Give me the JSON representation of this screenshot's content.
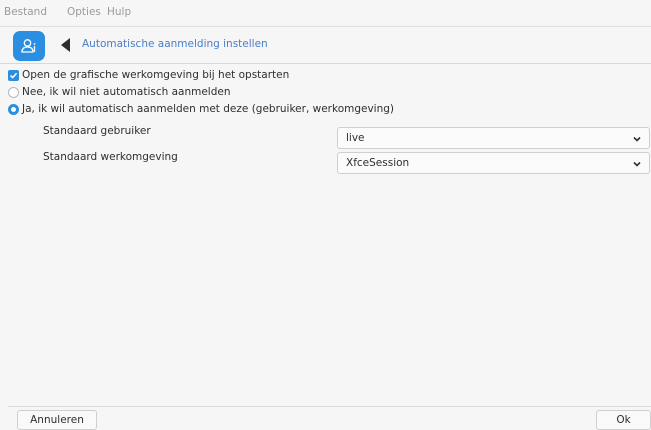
{
  "menubar": {
    "items": [
      {
        "label": "Bestand"
      },
      {
        "label": "Opties"
      },
      {
        "label": "Hulp"
      }
    ]
  },
  "header": {
    "icon": "user-autologin-icon",
    "title": "Automatische aanmelding instellen"
  },
  "options": {
    "launch_gui": {
      "label": "Open de grafische werkomgeving bij het opstarten",
      "checked": true
    },
    "no_autologin": {
      "label": "Nee, ik wil niet automatisch aanmelden",
      "selected": false
    },
    "yes_autologin": {
      "label": "Ja, ik wil automatisch aanmelden met deze (gebruiker, werkomgeving)",
      "selected": true
    }
  },
  "fields": {
    "default_user": {
      "label": "Standaard gebruiker",
      "value": "live"
    },
    "default_session": {
      "label": "Standaard werkomgeving",
      "value": "XfceSession"
    }
  },
  "footer": {
    "cancel_label": "Annuleren",
    "ok_label": "Ok"
  },
  "colors": {
    "accent": "#2a8fe0",
    "title_text": "#4a7cc8",
    "menu_text": "#9a9a9a"
  }
}
